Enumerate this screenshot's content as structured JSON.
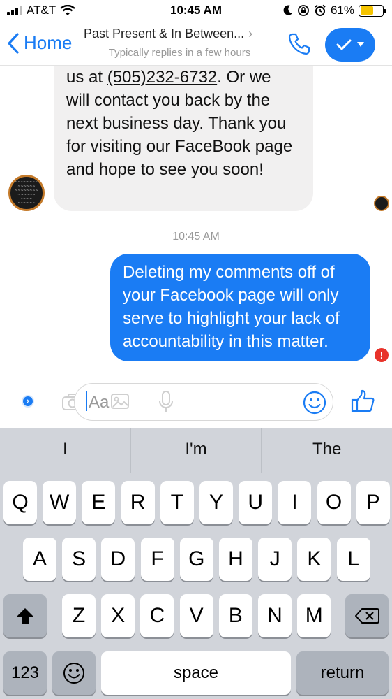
{
  "status_bar": {
    "carrier": "AT&T",
    "time": "10:45 AM",
    "battery_percent": "61%",
    "battery_level": 0.61,
    "battery_color": "#f5c400"
  },
  "header": {
    "back_label": "Home",
    "title": "Past Present & In Between...",
    "subtitle": "Typically replies in a few hours",
    "accent_color": "#1a7cf4"
  },
  "messages": {
    "incoming": {
      "line_1_prefix": "us at ",
      "phone_number": "(505)232-6732",
      "line_1_suffix": ". Or we",
      "rest": "will contact you back by the next business day. Thank you for visiting our FaceBook page and hope to see you soon!"
    },
    "timestamp": "10:45 AM",
    "outgoing": {
      "text": "Deleting my comments off of your Facebook page will only serve to highlight your lack of accountability in this matter.",
      "error_mark": "!"
    }
  },
  "composer": {
    "placeholder": "Aa",
    "icons": [
      "camera-icon",
      "image-icon",
      "microphone-icon",
      "emoji-icon",
      "thumbs-up-icon"
    ]
  },
  "keyboard": {
    "suggestions": [
      "I",
      "I'm",
      "The"
    ],
    "row1": [
      "Q",
      "W",
      "E",
      "R",
      "T",
      "Y",
      "U",
      "I",
      "O",
      "P"
    ],
    "row2": [
      "A",
      "S",
      "D",
      "F",
      "G",
      "H",
      "J",
      "K",
      "L"
    ],
    "row3": [
      "Z",
      "X",
      "C",
      "V",
      "B",
      "N",
      "M"
    ],
    "numbers_label": "123",
    "space_label": "space",
    "return_label": "return"
  }
}
